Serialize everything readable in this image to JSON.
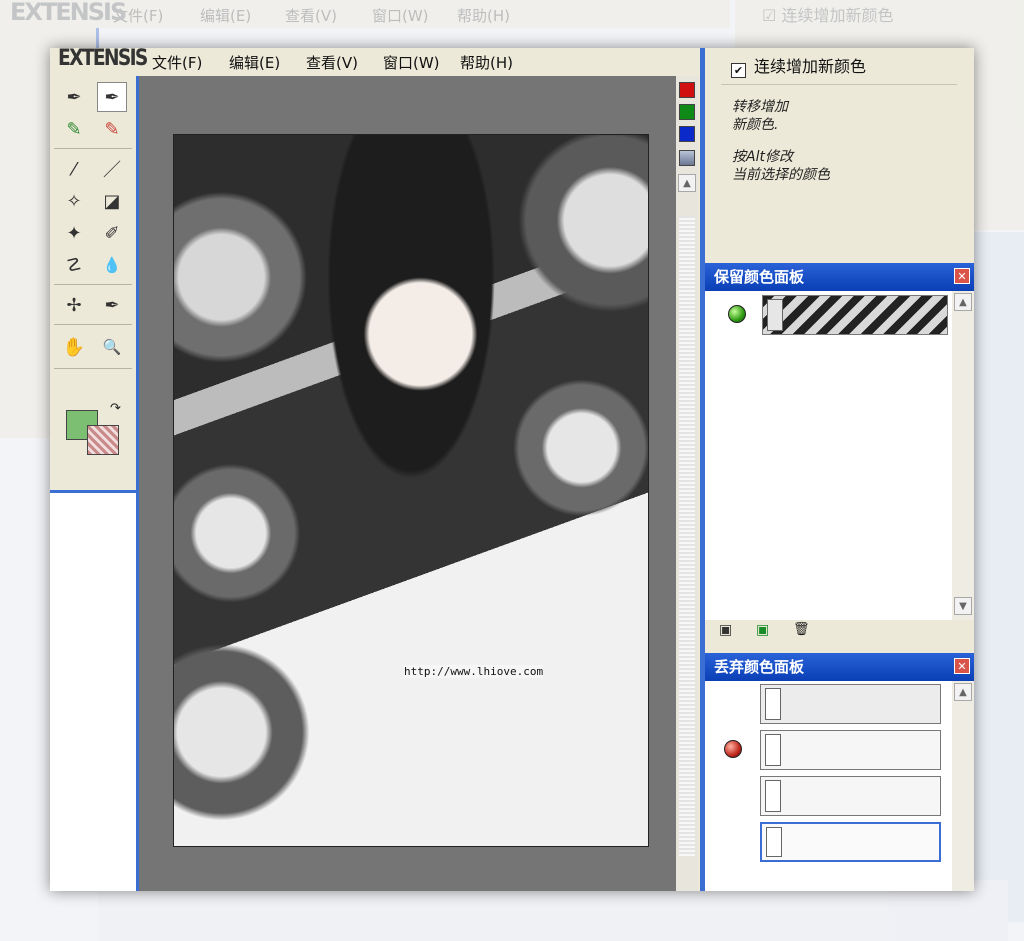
{
  "app": {
    "logo": "EXTENSIS"
  },
  "menu": {
    "items": [
      "文件(F)",
      "编辑(E)",
      "查看(V)",
      "窗口(W)",
      "帮助(H)"
    ]
  },
  "tools": [
    {
      "name": "eyedropper-icon",
      "glyph": "✒"
    },
    {
      "name": "eyedropper-selected-icon",
      "glyph": "✒"
    },
    {
      "name": "green-marker-icon",
      "glyph": "✎"
    },
    {
      "name": "red-marker-icon",
      "glyph": "✎"
    },
    {
      "name": "magic-brush-icon",
      "glyph": "⁄"
    },
    {
      "name": "brush-icon",
      "glyph": "／"
    },
    {
      "name": "magic-fill-icon",
      "glyph": "✧"
    },
    {
      "name": "fill-bucket-icon",
      "glyph": "◪"
    },
    {
      "name": "magic-wand-icon",
      "glyph": "✦"
    },
    {
      "name": "eraser-pencil-icon",
      "glyph": "✐"
    },
    {
      "name": "smudge-icon",
      "glyph": "☡"
    },
    {
      "name": "drop-icon",
      "glyph": "💧"
    },
    {
      "name": "pen-star-icon",
      "glyph": "✢"
    },
    {
      "name": "pen-nib-icon",
      "glyph": "✒"
    },
    {
      "name": "hand-icon",
      "glyph": "✋"
    },
    {
      "name": "zoom-icon",
      "glyph": "🔍"
    }
  ],
  "canvas": {
    "watermark_url": "http://www.lhiove.com",
    "color_chips": [
      "#d01010",
      "#0f8a16",
      "#0b29c8"
    ]
  },
  "options": {
    "continuous_add_label": "连续增加新颜色",
    "continuous_add_checked": "✔",
    "hint_1_line_1": "转移增加",
    "hint_1_line_2": "新颜色.",
    "hint_2_line_1": "按Alt修改",
    "hint_2_line_2": "当前选择的颜色"
  },
  "keep_panel": {
    "title": "保留颜色面板",
    "close": "✕"
  },
  "discard_panel": {
    "title": "丢弃颜色面板",
    "close": "✕"
  },
  "footer": {
    "new_icon": "▣",
    "add_icon": "▣",
    "delete_icon": "🗑"
  }
}
